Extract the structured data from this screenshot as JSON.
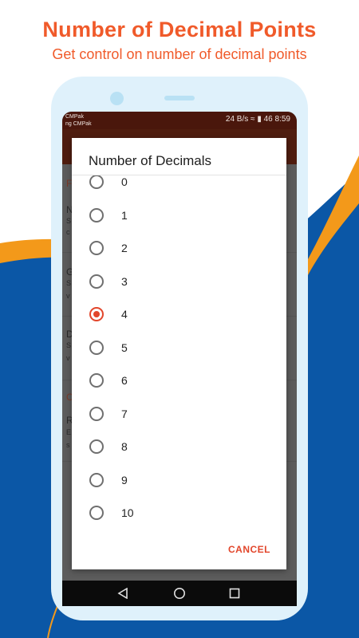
{
  "promo": {
    "title": "Number of Decimal Points",
    "subtitle": "Get control on number of decimal points"
  },
  "colors": {
    "accent": "#f05a2a",
    "blue": "#0b57a6",
    "orange": "#f3991a",
    "radio_selected": "#e2462b"
  },
  "status_bar": {
    "carrier_top": "CMPak",
    "carrier_bottom": "ng CMPak",
    "speed": "24 B/s",
    "battery": "46",
    "time": "8:59"
  },
  "dialog": {
    "title": "Number of Decimals",
    "options": [
      "0",
      "1",
      "2",
      "3",
      "4",
      "5",
      "6",
      "7",
      "8",
      "9",
      "10"
    ],
    "selected": "4",
    "cancel_label": "CANCEL"
  },
  "background_list": {
    "items": [
      "F",
      "N",
      "S",
      "c",
      "G",
      "S",
      "v",
      "D",
      "S",
      "v",
      "C",
      "R",
      "E",
      "s"
    ]
  },
  "navbar": {
    "icons": [
      "back-icon",
      "home-icon",
      "recents-icon"
    ]
  }
}
